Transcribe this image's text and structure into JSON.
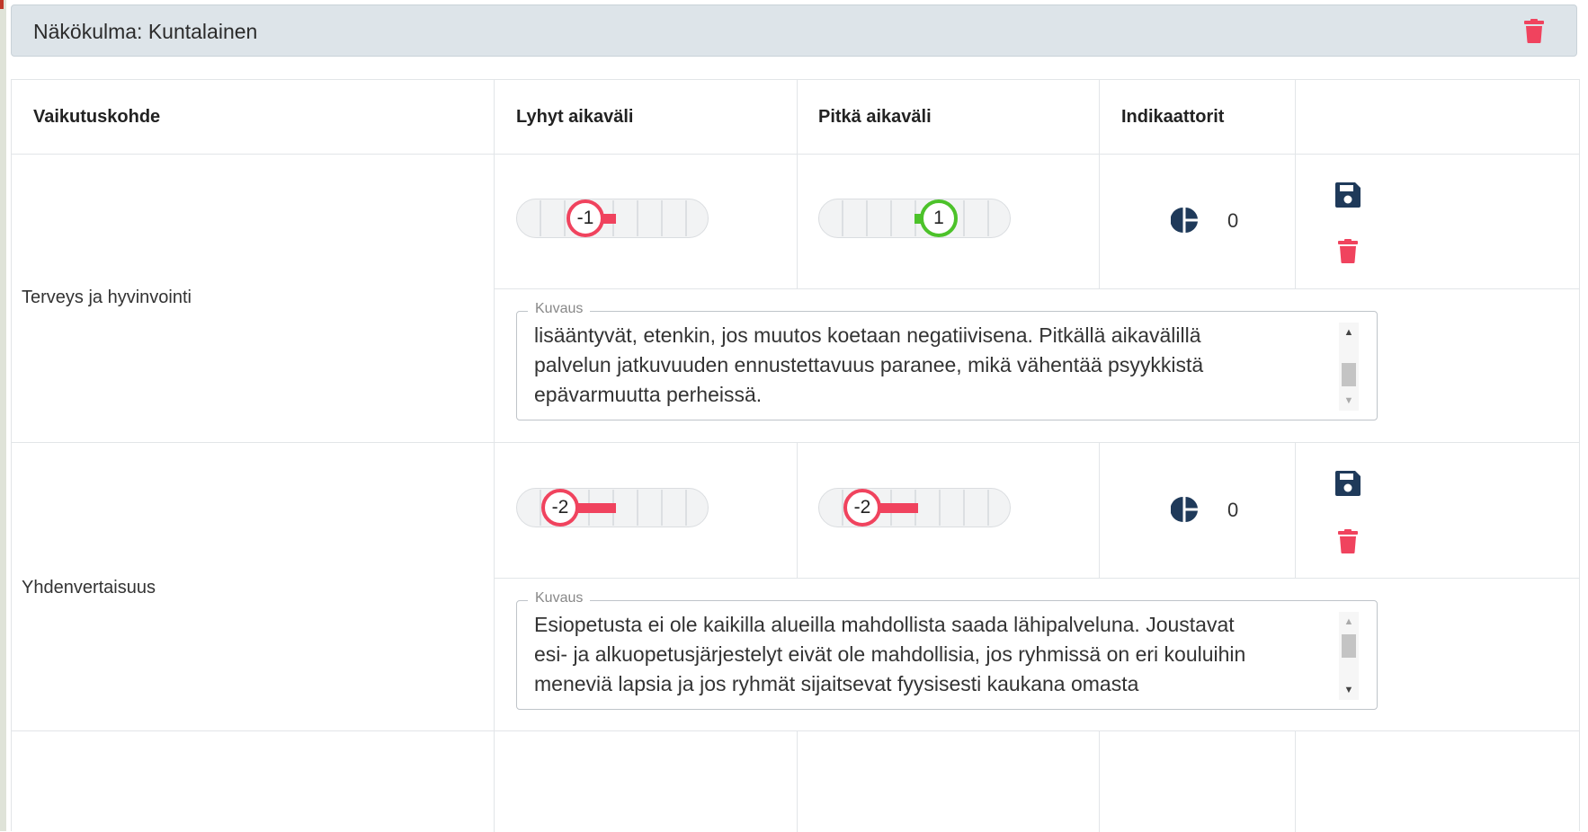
{
  "perspective": {
    "title": "Näkökulma: Kuntalainen"
  },
  "columns": {
    "target": "Vaikutuskohde",
    "short": "Lyhyt aikaväli",
    "long": "Pitkä aikaväli",
    "indicators": "Indikaattorit"
  },
  "colors": {
    "negative": "#f0435e",
    "positive": "#4cc22a",
    "icon": "#1f3a5a"
  },
  "rows": [
    {
      "label": "Terveys ja hyvinvointi",
      "short_value": "-1",
      "long_value": "1",
      "indicator_count": "0",
      "description_label": "Kuvaus",
      "description": "lisääntyvät, etenkin, jos muutos koetaan negatiivisena. Pitkällä aikavälillä\npalvelun jatkuvuuden ennustettavuus paranee, mikä vähentää psyykkistä\nepävarmuutta perheissä."
    },
    {
      "label": "Yhdenvertaisuus",
      "short_value": "-2",
      "long_value": "-2",
      "indicator_count": "0",
      "description_label": "Kuvaus",
      "description": "Esiopetusta ei ole kaikilla alueilla mahdollista saada lähipalveluna. Joustavat\nesi- ja alkuopetusjärjestelyt eivät ole mahdollisia, jos ryhmissä on eri kouluihin\nmeneviä lapsia ja jos ryhmät sijaitsevat fyysisesti kaukana omasta"
    }
  ]
}
